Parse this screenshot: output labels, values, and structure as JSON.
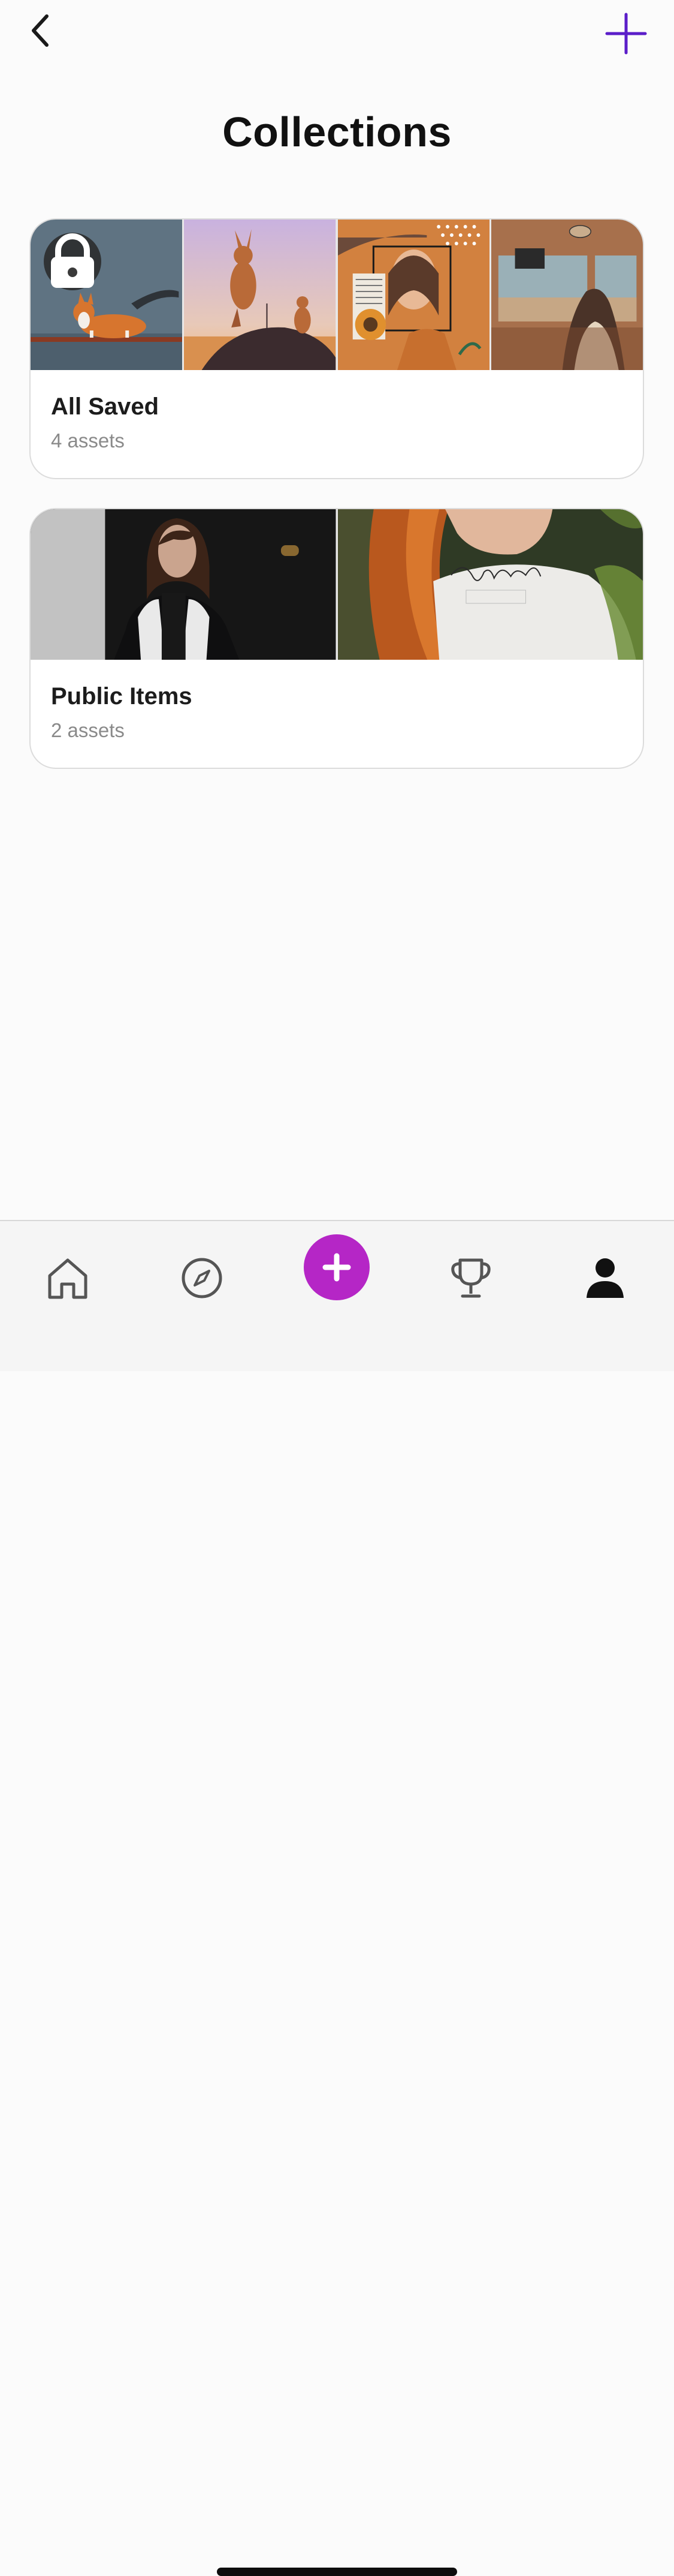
{
  "header": {
    "back_icon": "chevron-left-icon",
    "add_icon": "plus-icon",
    "accent_color": "#5b1ec9"
  },
  "page": {
    "title": "Collections"
  },
  "collections": [
    {
      "name": "All Saved",
      "count": "4 assets",
      "private": true,
      "lock_icon": "lock-icon",
      "thumbnails": [
        "corgi-fox-image",
        "kangaroo-dog-image",
        "portrait-collage-image",
        "train-window-image"
      ]
    },
    {
      "name": "Public Items",
      "count": "2 assets",
      "private": false,
      "thumbnails": [
        "woman-jacket-image",
        "thursday-shirt-image"
      ]
    }
  ],
  "tab_bar": {
    "items": [
      {
        "name": "home",
        "icon": "home-icon"
      },
      {
        "name": "explore",
        "icon": "compass-icon"
      },
      {
        "name": "create",
        "icon": "plus-icon",
        "color": "#b526c6"
      },
      {
        "name": "leaderboard",
        "icon": "trophy-icon"
      },
      {
        "name": "profile",
        "icon": "person-icon",
        "active": true
      }
    ]
  }
}
